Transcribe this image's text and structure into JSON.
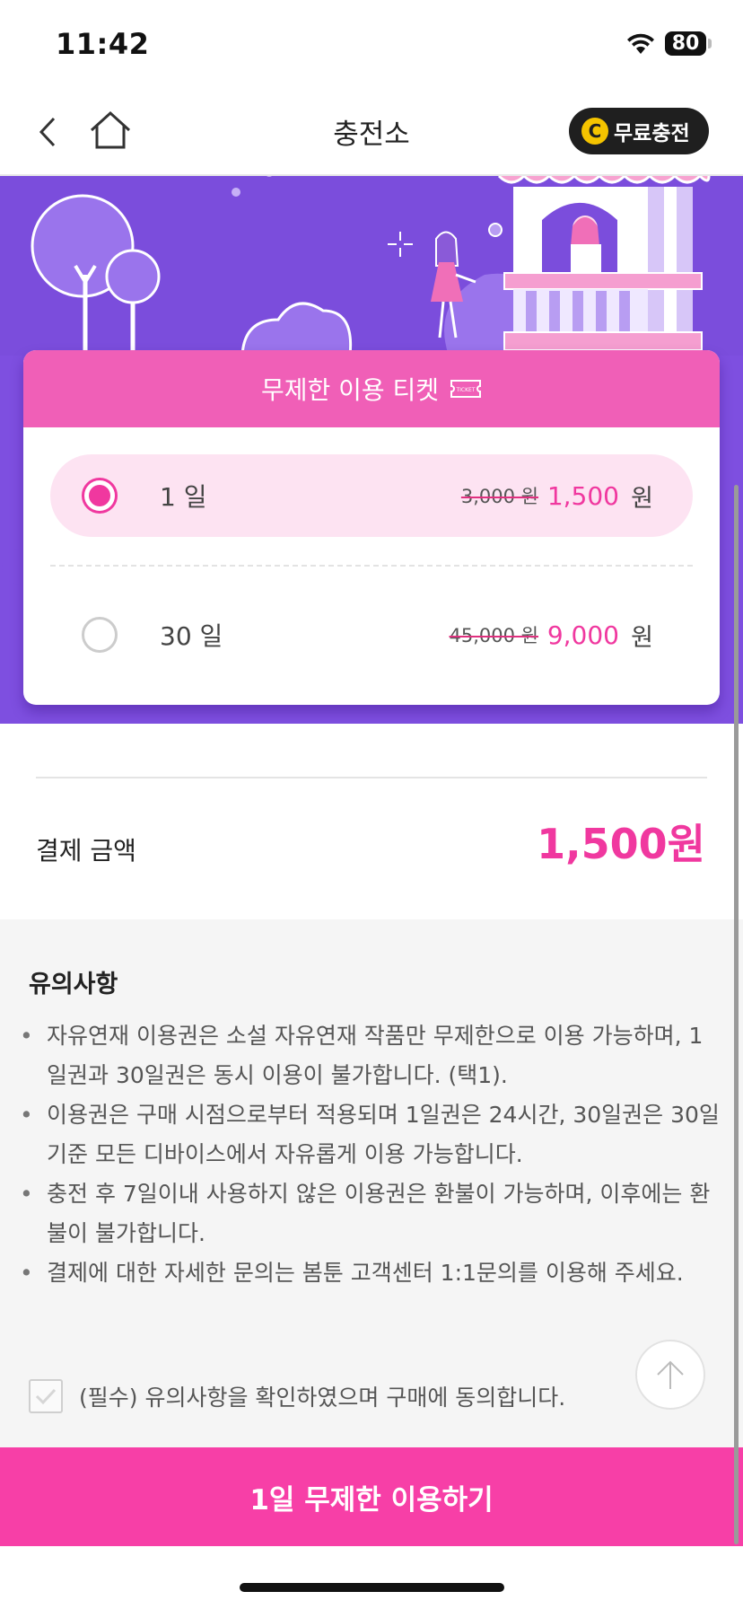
{
  "status_bar": {
    "time": "11:42",
    "battery": "80"
  },
  "nav": {
    "title": "충전소",
    "free_charge_label": "무료충전",
    "coin_symbol": "C",
    "back_icon": "chevron-left-icon",
    "home_icon": "home-icon"
  },
  "ticket": {
    "header": "무제한 이용 티켓",
    "ticket_icon_text": "TICKET",
    "options": [
      {
        "label": "1 일",
        "original_price": "3,000 원",
        "price": "1,500",
        "unit": "원",
        "selected": true
      },
      {
        "label": "30 일",
        "original_price": "45,000 원",
        "price": "9,000",
        "unit": "원",
        "selected": false
      }
    ]
  },
  "payment": {
    "label": "결제 금액",
    "amount": "1,500원"
  },
  "notices": {
    "title": "유의사항",
    "items": [
      "자유연재 이용권은 소설 자유연재 작품만 무제한으로 이용 가능하며, 1일권과 30일권은 동시 이용이 불가합니다. (택1).",
      "이용권은 구매 시점으로부터 적용되며 1일권은 24시간, 30일권은 30일 기준 모든 디바이스에서 자유롭게 이용 가능합니다.",
      "충전 후 7일이내 사용하지 않은 이용권은 환불이 가능하며, 이후에는 환불이 불가합니다.",
      "결제에 대한 자세한 문의는 봄툰 고객센터 1:1문의를 이용해 주세요."
    ],
    "agree_text": "(필수) 유의사항을 확인하였으며 구매에 동의합니다."
  },
  "cta": {
    "label": "1일 무제한 이용하기"
  },
  "colors": {
    "accent": "#f0389f",
    "banner": "#7e4fe0",
    "cta": "#f73fa7"
  }
}
